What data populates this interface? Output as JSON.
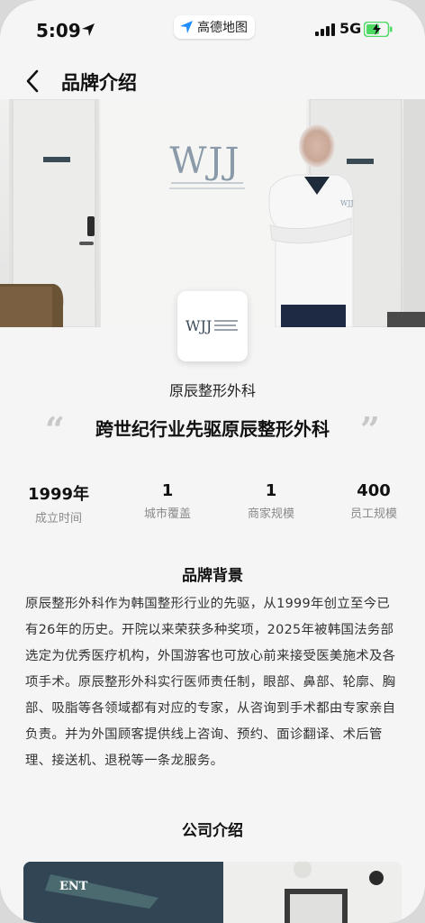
{
  "status_bar": {
    "time": "5:09",
    "app_name": "高德地图",
    "network": "5G"
  },
  "nav": {
    "title": "品牌介绍"
  },
  "hero": {
    "logo_text": "WJJ"
  },
  "brand": {
    "name": "原辰整形外科",
    "slogan": "跨世纪行业先驱原辰整形外科",
    "quote_open": "“",
    "quote_close": "”"
  },
  "stats": [
    {
      "value": "1999年",
      "label": "成立时间"
    },
    {
      "value": "1",
      "label": "城市覆盖"
    },
    {
      "value": "1",
      "label": "商家规模"
    },
    {
      "value": "400",
      "label": "员工规模"
    }
  ],
  "background": {
    "title": "品牌背景",
    "text": "原辰整形外科作为韩国整形行业的先驱，从1999年创立至今已有26年的历史。开院以来荣获多种奖项，2025年被韩国法务部选定为优秀医疗机构，外国游客也可放心前来接受医美施术及各项手术。原辰整形外科实行医师责任制，眼部、鼻部、轮廓、胸部、吸脂等各领域都有对应的专家，从咨询到手术都由专家亲自负责。并为外国顾客提供线上咨询、预约、面诊翻译、术后管理、接送机、退税等一条龙服务。"
  },
  "company": {
    "title": "公司介绍",
    "sign_text": "ENT"
  },
  "colors": {
    "background": "#f5f5f5",
    "text_primary": "#111111",
    "text_secondary": "#8a8a8a",
    "battery_charging": "#4cd964"
  }
}
